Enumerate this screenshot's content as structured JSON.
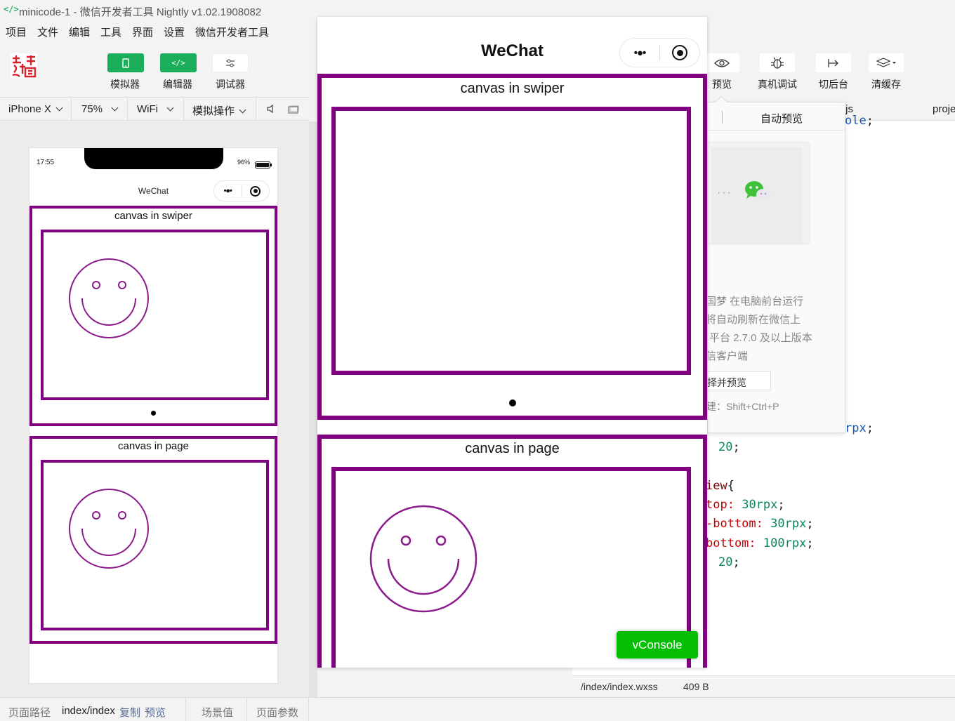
{
  "window": {
    "title": "minicode-1 - 微信开发者工具 Nightly v1.02.1908082",
    "title_icon": "code-brackets-icon"
  },
  "menu": {
    "items": [
      "项目",
      "文件",
      "编辑",
      "工具",
      "界面",
      "设置",
      "微信开发者工具"
    ]
  },
  "toolbar": {
    "simulator_label": "模拟器",
    "editor_label": "编辑器",
    "debugger_label": "调试器",
    "preview_label": "预览",
    "realdevice_label": "真机调试",
    "background_label": "切后台",
    "clearcache_label": "清缓存",
    "accent_color": "#1aad5a"
  },
  "device_bar": {
    "device": "iPhone X",
    "zoom": "75%",
    "network": "WiFi",
    "simulate_ops": "模拟操作"
  },
  "phone": {
    "time": "17:55",
    "battery": "96%",
    "nav_title": "WeChat",
    "swiper_caption": "canvas in swiper",
    "page_caption": "canvas in page",
    "frame_color": "#800080"
  },
  "big_preview": {
    "nav_title": "WeChat",
    "swiper_caption": "canvas in swiper",
    "page_caption": "canvas in page",
    "vconsole_label": "vConsole"
  },
  "preview_popup": {
    "tab_label": "自动预览",
    "line1": "国梦 在电脑前台运行",
    "line2": "将自动刷新在微信上",
    "line3": "平台 2.7.0 及以上版本",
    "line4": "信客户端",
    "button_label": "择并预览",
    "shortcut": "建：Shift+Ctrl+P"
  },
  "editor": {
    "tab_js": ".js",
    "tab_proj": "proje",
    "lines": [
      {
        "a": "ole",
        "b": ";"
      },
      {
        "a": "rpx",
        "b": ";"
      },
      {
        "a": "20",
        "b": ";"
      },
      {
        "a": "iew",
        "b": "{"
      },
      {
        "k": "top:",
        "v": "30rpx",
        "e": ";"
      },
      {
        "k": "-bottom:",
        "v": "30rpx",
        "e": ";"
      },
      {
        "k": "bottom:",
        "v": "100rpx",
        "e": ";"
      },
      {
        "a": "20",
        "b": ";"
      }
    ]
  },
  "file_status": {
    "path": "/index/index.wxss",
    "size": "409 B"
  },
  "status_bar": {
    "path_label": "页面路径",
    "path_value": "index/index",
    "copy": "复制",
    "preview": "预览",
    "scene": "场景值",
    "params": "页面参数"
  }
}
